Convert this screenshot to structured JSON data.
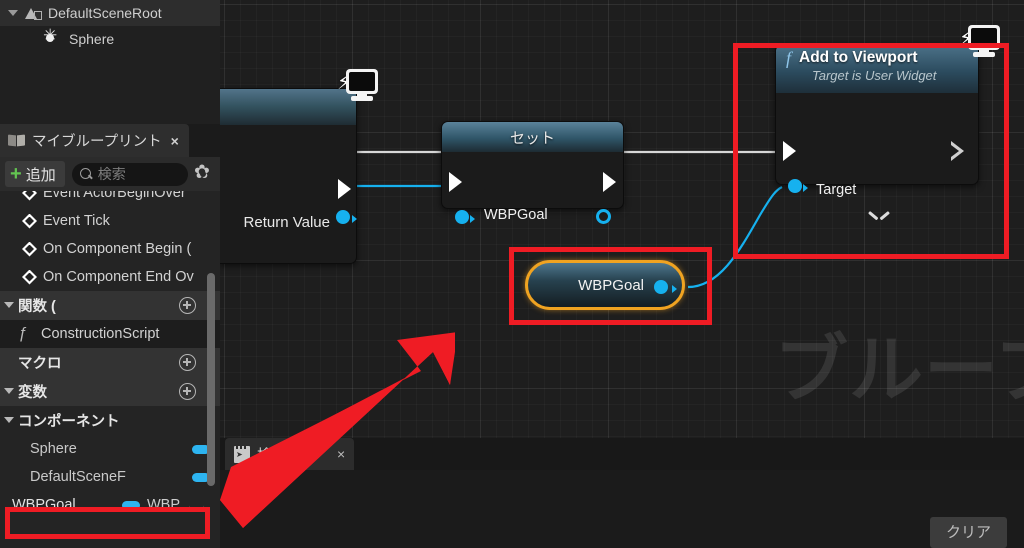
{
  "outliner": {
    "items": [
      {
        "label": "DefaultSceneRoot",
        "icon": "scene-root-icon",
        "expanded": true
      },
      {
        "label": "Sphere",
        "icon": "sphere-icon",
        "expanded": false
      }
    ]
  },
  "my_blueprint": {
    "tab_label": "マイブループリント",
    "tab_close": "×",
    "add_label": "追加",
    "add_plus": "+",
    "search_placeholder": "検索",
    "gear_icon": "gear-icon",
    "events": [
      {
        "label": "Event ActorBeginOver"
      },
      {
        "label": "Event Tick"
      },
      {
        "label": "On Component Begin ("
      },
      {
        "label": "On Component End Ov"
      }
    ],
    "sections": {
      "functions": "関数 (",
      "macros": "マクロ",
      "variables": "変数",
      "components": "コンポーネント"
    },
    "construction_script": "ConstructionScript",
    "components": [
      {
        "name": "Sphere",
        "type": "",
        "pill": true,
        "eye": false
      },
      {
        "name": "DefaultSceneF",
        "type": "",
        "pill": true,
        "eye": false
      },
      {
        "name": "WBPGoal",
        "type": "WBP",
        "pill": true,
        "eye": true
      }
    ]
  },
  "graph": {
    "watermark": "ブルーブリント",
    "nodes": {
      "event": {
        "return_value_label": "Return Value",
        "badge_icon": "viewport-monitor-icon"
      },
      "set": {
        "title": "セット",
        "variable_label": "WBPGoal"
      },
      "add_to_viewport": {
        "title": "Add to Viewport",
        "subtitle": "Target is User Widget",
        "target_label": "Target",
        "f_glyph": "f",
        "badge_icon": "viewport-monitor-icon",
        "expand_icon": "chevron-down-icon"
      },
      "get_variable": {
        "label": "WBPGoal"
      }
    },
    "annotations": {
      "arrow_color": "#ef1c24",
      "box_color": "#ef1c24",
      "highlight_color": "#f0a321"
    }
  },
  "bottom_panel": {
    "tab_label": "検索結果",
    "tab_close": "×",
    "clear_label": "クリア"
  },
  "colors": {
    "exec_wire": "#d8d8d8",
    "data_wire": "#16b1ef",
    "pin_blue": "#16b1ef",
    "accent_green": "#63c451",
    "panel_bg": "#242424",
    "graph_bg": "#1e1e1e"
  }
}
